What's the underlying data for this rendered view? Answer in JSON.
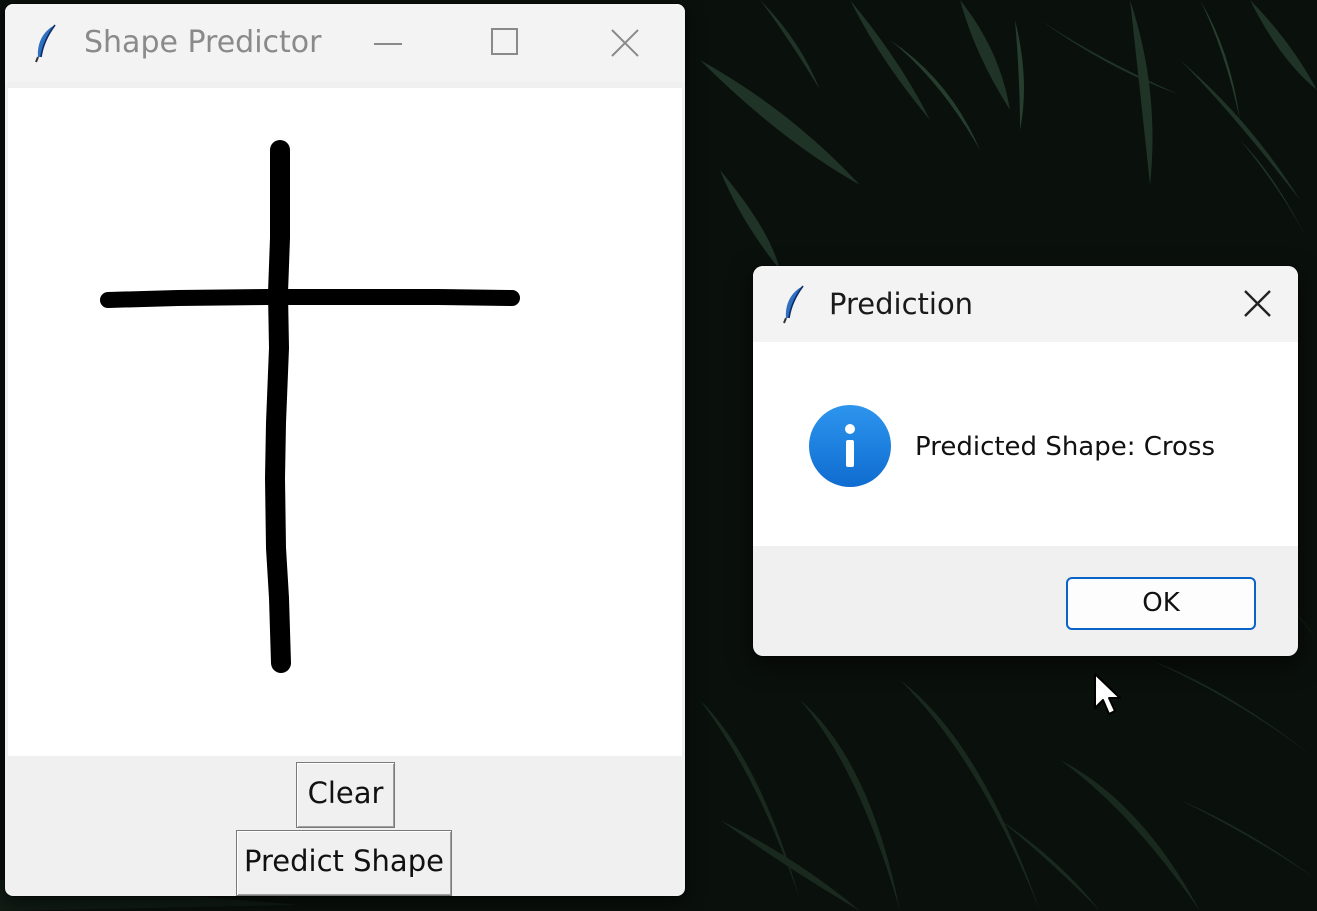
{
  "main_window": {
    "title": "Shape Predictor",
    "title_icon": "feather-icon",
    "buttons": {
      "clear_label": "Clear",
      "predict_label": "Predict Shape"
    },
    "caption_icons": [
      "minimize-icon",
      "maximize-icon",
      "close-icon"
    ]
  },
  "dialog": {
    "title": "Prediction",
    "title_icon": "feather-icon",
    "message": "Predicted Shape: Cross",
    "status_icon": "info-icon",
    "ok_label": "OK",
    "accent_color": "#0a64c8",
    "info_icon_color": "#1a7fe0"
  }
}
